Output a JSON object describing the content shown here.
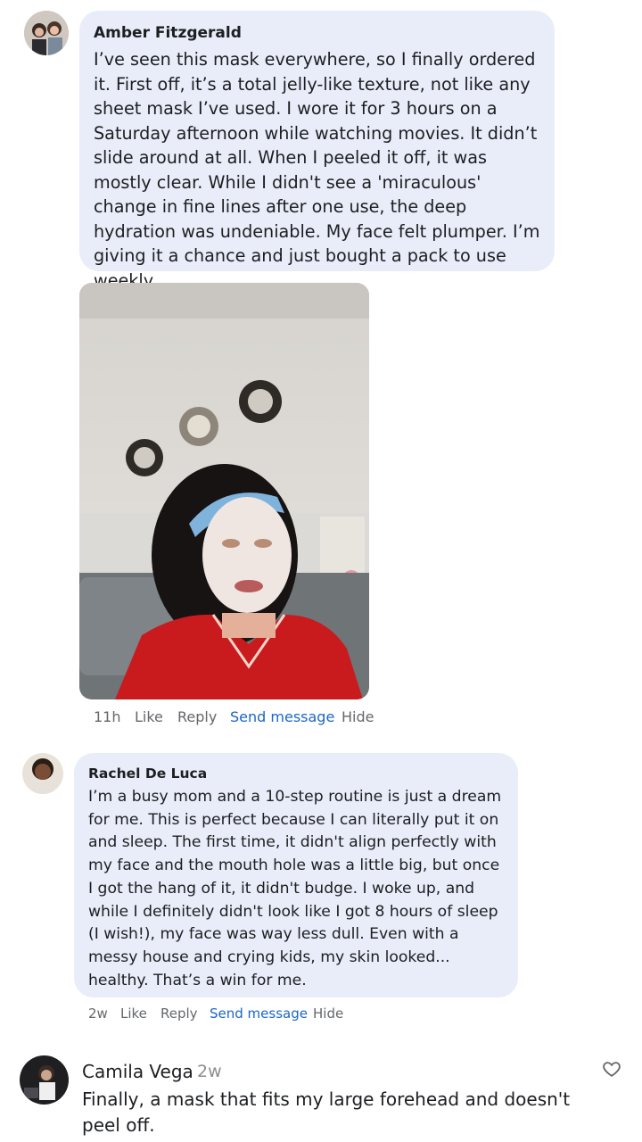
{
  "comments": [
    {
      "author": "Amber Fitzgerald",
      "text": "I’ve seen this mask everywhere, so I finally ordered it. First off, it’s a total jelly-like texture, not like any sheet mask I’ve used. I wore it for 3 hours on a Saturday afternoon while watching movies. It didn’t slide around at all. When I peeled it off, it was mostly clear. While I didn't see a 'miraculous' change in fine lines after one use, the deep hydration was undeniable. My face felt plumper. I’m giving it a chance and just bought a pack to use weekly.",
      "time": "11h",
      "like": "Like",
      "reply": "Reply",
      "send_message": "Send message",
      "hide": "Hide"
    },
    {
      "author": "Rachel De Luca",
      "text": "I’m a busy mom and a 10-step routine is just a dream for me. This is perfect because I can literally put it on and sleep. The first time, it didn't align perfectly with my face and the mouth hole was a little big, but once I got the hang of it, it didn't budge. I woke up, and while I definitely didn't look like I got 8 hours of sleep (I wish!), my face was way less dull. Even with a messy house and crying kids, my skin looked... healthy. That’s a win for me.",
      "time": "2w",
      "like": "Like",
      "reply": "Reply",
      "send_message": "Send message",
      "hide": "Hide"
    },
    {
      "author": "Camila Vega",
      "time": "2w",
      "text": "Finally, a mask that fits my large forehead and doesn't peel off."
    }
  ],
  "colors": {
    "bubble": "#e8edf9",
    "link": "#1b66c9",
    "meta": "#65676b"
  },
  "icons": {
    "like_heart": "heart-outline-icon"
  }
}
